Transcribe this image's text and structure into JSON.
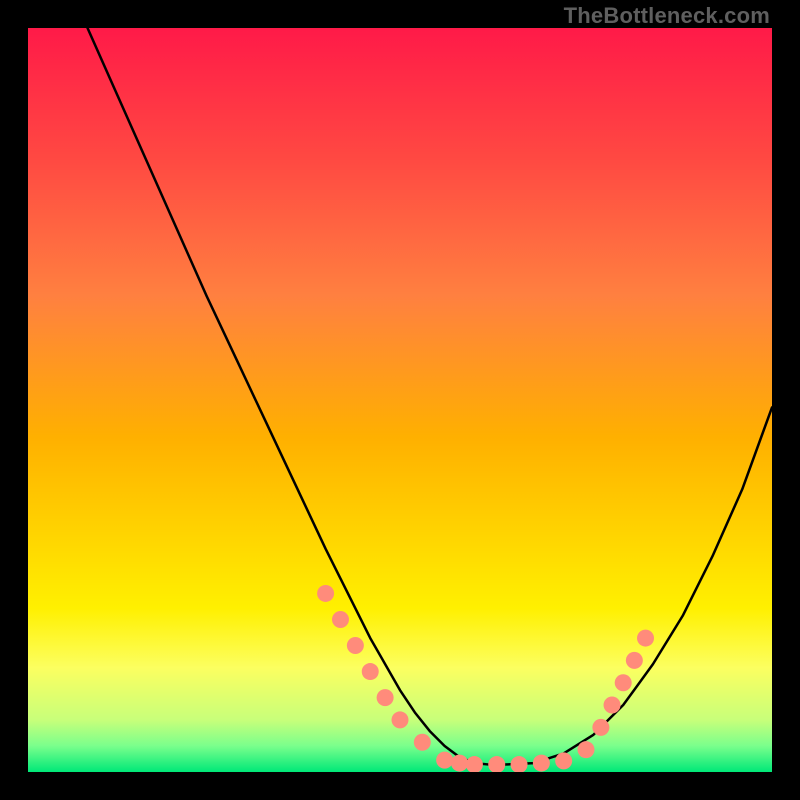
{
  "watermark": {
    "text": "TheBottleneck.com"
  },
  "chart_data": {
    "type": "line",
    "title": "",
    "xlabel": "",
    "ylabel": "",
    "xlim": [
      0,
      100
    ],
    "ylim": [
      0,
      100
    ],
    "gradient_colors": {
      "top": "#ff1a48",
      "mid1": "#ff8040",
      "mid2": "#ffd400",
      "mid3": "#fff000",
      "mid4": "#fcff60",
      "low": "#c8ff7a",
      "bottom": "#00e878"
    },
    "series": [
      {
        "name": "curve",
        "color": "#000000",
        "x": [
          8,
          12,
          16,
          20,
          24,
          28,
          32,
          36,
          40,
          42,
          44,
          46,
          48,
          50,
          52,
          54,
          56,
          58,
          60,
          62,
          64,
          68,
          72,
          76,
          80,
          84,
          88,
          92,
          96,
          100
        ],
        "y": [
          100,
          91,
          82,
          73,
          64,
          55.5,
          47,
          38.5,
          30,
          26,
          22,
          18,
          14.5,
          11,
          8,
          5.5,
          3.5,
          2,
          1.2,
          1,
          1,
          1.2,
          2.5,
          5,
          9,
          14.5,
          21,
          29,
          38,
          49
        ]
      }
    ],
    "markers": {
      "color": "#ff8b7b",
      "points": [
        {
          "x": 40,
          "y": 24
        },
        {
          "x": 42,
          "y": 20.5
        },
        {
          "x": 44,
          "y": 17
        },
        {
          "x": 46,
          "y": 13.5
        },
        {
          "x": 48,
          "y": 10
        },
        {
          "x": 50,
          "y": 7
        },
        {
          "x": 53,
          "y": 4
        },
        {
          "x": 56,
          "y": 1.6
        },
        {
          "x": 58,
          "y": 1.2
        },
        {
          "x": 60,
          "y": 1
        },
        {
          "x": 63,
          "y": 1
        },
        {
          "x": 66,
          "y": 1
        },
        {
          "x": 69,
          "y": 1.2
        },
        {
          "x": 72,
          "y": 1.5
        },
        {
          "x": 75,
          "y": 3
        },
        {
          "x": 77,
          "y": 6
        },
        {
          "x": 78.5,
          "y": 9
        },
        {
          "x": 80,
          "y": 12
        },
        {
          "x": 81.5,
          "y": 15
        },
        {
          "x": 83,
          "y": 18
        }
      ]
    }
  }
}
